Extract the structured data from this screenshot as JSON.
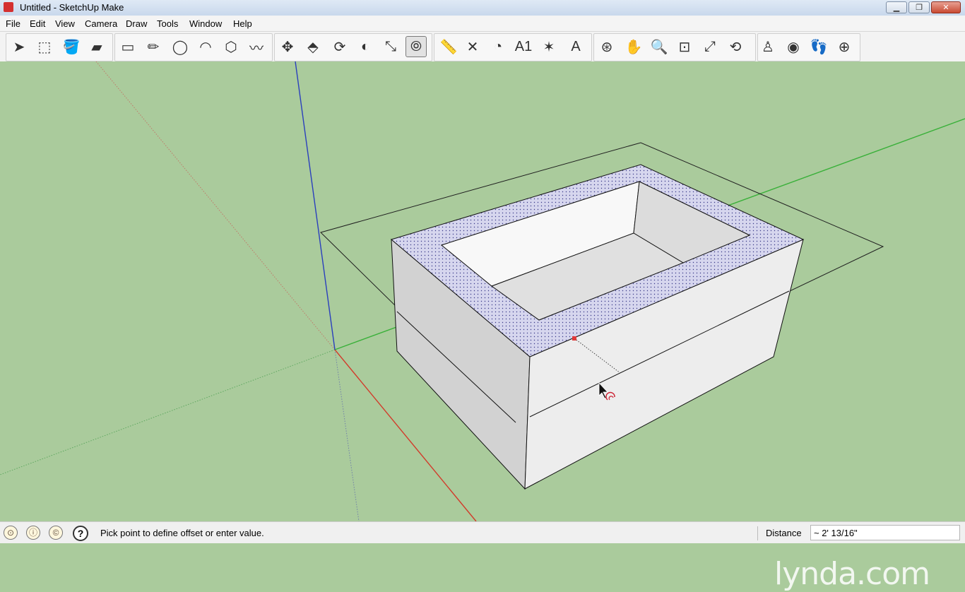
{
  "window": {
    "title": "Untitled - SketchUp Make",
    "minimize": "▁",
    "maximize": "❐",
    "close": "✕"
  },
  "menu": [
    "File",
    "Edit",
    "View",
    "Camera",
    "Draw",
    "Tools",
    "Window",
    "Help"
  ],
  "toolbar": {
    "tools": [
      {
        "name": "select-tool",
        "icon": "arrow-cursor",
        "glyph": "➤"
      },
      {
        "name": "make-component-tool",
        "icon": "component-box",
        "glyph": "⬚"
      },
      {
        "name": "paint-bucket-tool",
        "icon": "paint-bucket",
        "glyph": "🪣"
      },
      {
        "name": "eraser-tool",
        "icon": "eraser",
        "glyph": "▰"
      },
      {
        "name": "rectangle-tool",
        "icon": "rectangle",
        "glyph": "▭"
      },
      {
        "name": "line-tool",
        "icon": "pencil",
        "glyph": "✏"
      },
      {
        "name": "circle-tool",
        "icon": "circle",
        "glyph": "◯"
      },
      {
        "name": "arc-tool",
        "icon": "arc",
        "glyph": "◠"
      },
      {
        "name": "polygon-tool",
        "icon": "polygon",
        "glyph": "⬡"
      },
      {
        "name": "freehand-tool",
        "icon": "freehand",
        "glyph": "〰"
      },
      {
        "name": "move-tool",
        "icon": "move-arrows",
        "glyph": "✥"
      },
      {
        "name": "push-pull-tool",
        "icon": "push-pull",
        "glyph": "⬘"
      },
      {
        "name": "rotate-tool",
        "icon": "rotate",
        "glyph": "⟳"
      },
      {
        "name": "follow-me-tool",
        "icon": "follow-me",
        "glyph": "◐"
      },
      {
        "name": "scale-tool",
        "icon": "scale",
        "glyph": "⤡"
      },
      {
        "name": "offset-tool",
        "icon": "offset",
        "glyph": "⦾"
      },
      {
        "name": "tape-measure-tool",
        "icon": "tape-measure",
        "glyph": "📏"
      },
      {
        "name": "dimension-tool",
        "icon": "dimension",
        "glyph": "✕"
      },
      {
        "name": "protractor-tool",
        "icon": "protractor",
        "glyph": "◔"
      },
      {
        "name": "text-tool",
        "icon": "text-label",
        "glyph": "A1"
      },
      {
        "name": "axes-tool",
        "icon": "axes",
        "glyph": "✶"
      },
      {
        "name": "3d-text-tool",
        "icon": "3d-text",
        "glyph": "A"
      },
      {
        "name": "orbit-tool",
        "icon": "orbit",
        "glyph": "⊛"
      },
      {
        "name": "pan-tool",
        "icon": "hand",
        "glyph": "✋"
      },
      {
        "name": "zoom-tool",
        "icon": "magnifier",
        "glyph": "🔍"
      },
      {
        "name": "zoom-window-tool",
        "icon": "zoom-window",
        "glyph": "⊡"
      },
      {
        "name": "zoom-extents-tool",
        "icon": "zoom-extents",
        "glyph": "⤢"
      },
      {
        "name": "previous-view-tool",
        "icon": "previous-view",
        "glyph": "⟲"
      },
      {
        "name": "position-camera-tool",
        "icon": "position-camera",
        "glyph": "♙"
      },
      {
        "name": "look-around-tool",
        "icon": "eye",
        "glyph": "◉"
      },
      {
        "name": "walk-tool",
        "icon": "footprints",
        "glyph": "👣"
      },
      {
        "name": "section-plane-tool",
        "icon": "section-plane",
        "glyph": "⊕"
      }
    ],
    "active": "offset-tool"
  },
  "status": {
    "message": "Pick point to define offset or enter value.",
    "vcb_label": "Distance",
    "vcb_value": "~ 2' 13/16\""
  },
  "watermark": "lynda.com",
  "colors": {
    "viewport_bg": "#aacb9c",
    "selected_face": "#d6d6ee",
    "axis_red": "#d23a2a",
    "axis_green": "#39b039",
    "axis_blue": "#2a3fbd"
  }
}
